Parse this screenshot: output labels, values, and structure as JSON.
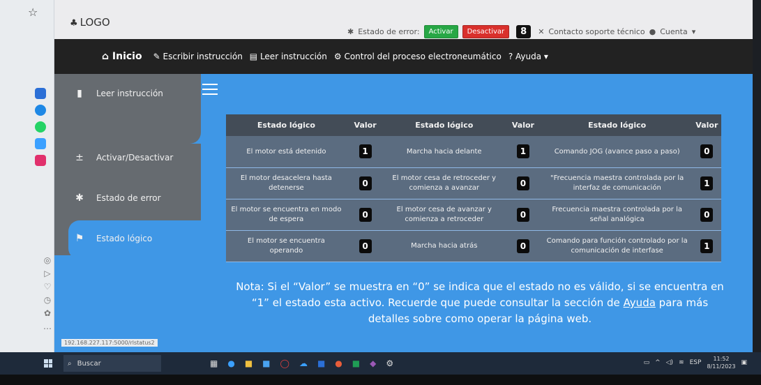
{
  "header": {
    "logo": "LOGO",
    "error_state_label": "Estado de error:",
    "activate_label": "Activar",
    "deactivate_label": "Desactivar",
    "error_count": "8",
    "support_label": "Contacto soporte técnico",
    "account_label": "Cuenta"
  },
  "nav": {
    "home": "Inicio",
    "write": "Escribir instrucción",
    "read": "Leer instrucción",
    "control": "Control del proceso electroneumático",
    "help": "Ayuda"
  },
  "sidebar": {
    "items": [
      {
        "label": "Leer instrucción"
      },
      {
        "label": "Activar/Desactivar"
      },
      {
        "label": "Estado de error"
      },
      {
        "label": "Estado lógico"
      }
    ]
  },
  "table": {
    "headers": [
      "Estado lógico",
      "Valor",
      "Estado lógico",
      "Valor",
      "Estado lógico",
      "Valor"
    ],
    "rows": [
      [
        "El motor está detenido",
        "1",
        "Marcha hacia delante",
        "1",
        "Comando JOG (avance paso a paso)",
        "0"
      ],
      [
        "El motor desacelera hasta detenerse",
        "0",
        "El motor cesa de retroceder y comienza a avanzar",
        "0",
        "\"Frecuencia maestra controlada por la interfaz de comunicación",
        "1"
      ],
      [
        "El motor se encuentra en modo de espera",
        "0",
        "El motor cesa de avanzar y comienza a retroceder",
        "0",
        "Frecuencia maestra controlada por la señal analógica",
        "0"
      ],
      [
        "El motor se encuentra operando",
        "0",
        "Marcha hacia atrás",
        "0",
        "Comando para función controlado por la comunicación de interfase",
        "1"
      ]
    ]
  },
  "note": {
    "before_link": "Nota: Si el “Valor” se muestra en “0” se indica que el estado no es válido, si se encuentra en “1” el estado esta activo. Recuerde que puede consultar la sección de ",
    "link": "Ayuda",
    "after_link": " para más detalles sobre como operar la página web."
  },
  "status_url": "192.168.227.117:5000/rlstatus2",
  "taskbar": {
    "search": "Buscar",
    "lang": "ESP",
    "time": "11:52",
    "date": "8/11/2023"
  }
}
